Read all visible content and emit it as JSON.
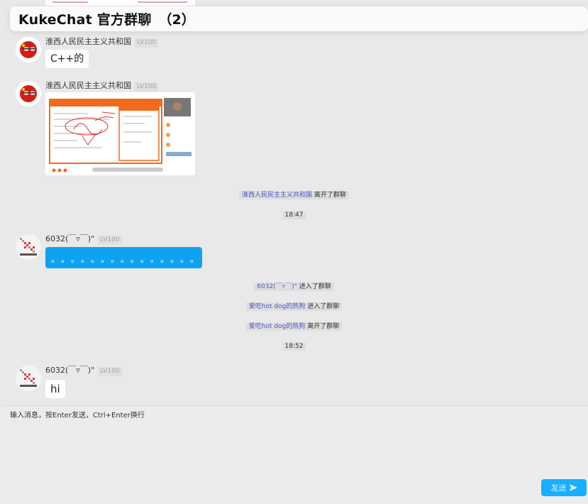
{
  "header": {
    "title": "KukeChat 官方群聊",
    "count": "（2）"
  },
  "messages": [
    {
      "name": "淮西人民民主主义共和国",
      "level": "LV100",
      "text": "C++的"
    },
    {
      "name": "淮西人民民主主义共和国",
      "level": "LV100",
      "image": "screenshot"
    },
    {
      "name": "6032(￣▿￣)\"",
      "level": "LV100",
      "text": "。。。。。。。。。。。。。。。"
    },
    {
      "name": "6032(￣▿￣)\"",
      "level": "LV100",
      "text": "hi"
    }
  ],
  "notices": [
    {
      "who": "淮西人民民主主义共和国",
      "action": " 离开了群聊"
    },
    {
      "who": "6032(￣▿￣)\"",
      "action": " 进入了群聊"
    },
    {
      "who": "爱吃hot dog的热狗",
      "action": " 进入了群聊"
    },
    {
      "who": "爱吃hot dog的热狗",
      "action": " 离开了群聊"
    }
  ],
  "times": [
    "18:47",
    "18:52"
  ],
  "composer": {
    "placeholder": "输入消息，按Enter发送，Ctrl+Enter换行",
    "send_label": "发送",
    "send_icon": "send-arrow-icon"
  },
  "colors": {
    "accent": "#17b0ff",
    "bubble_blue": "#0ea3f2",
    "notice_link": "#4b55c7"
  }
}
